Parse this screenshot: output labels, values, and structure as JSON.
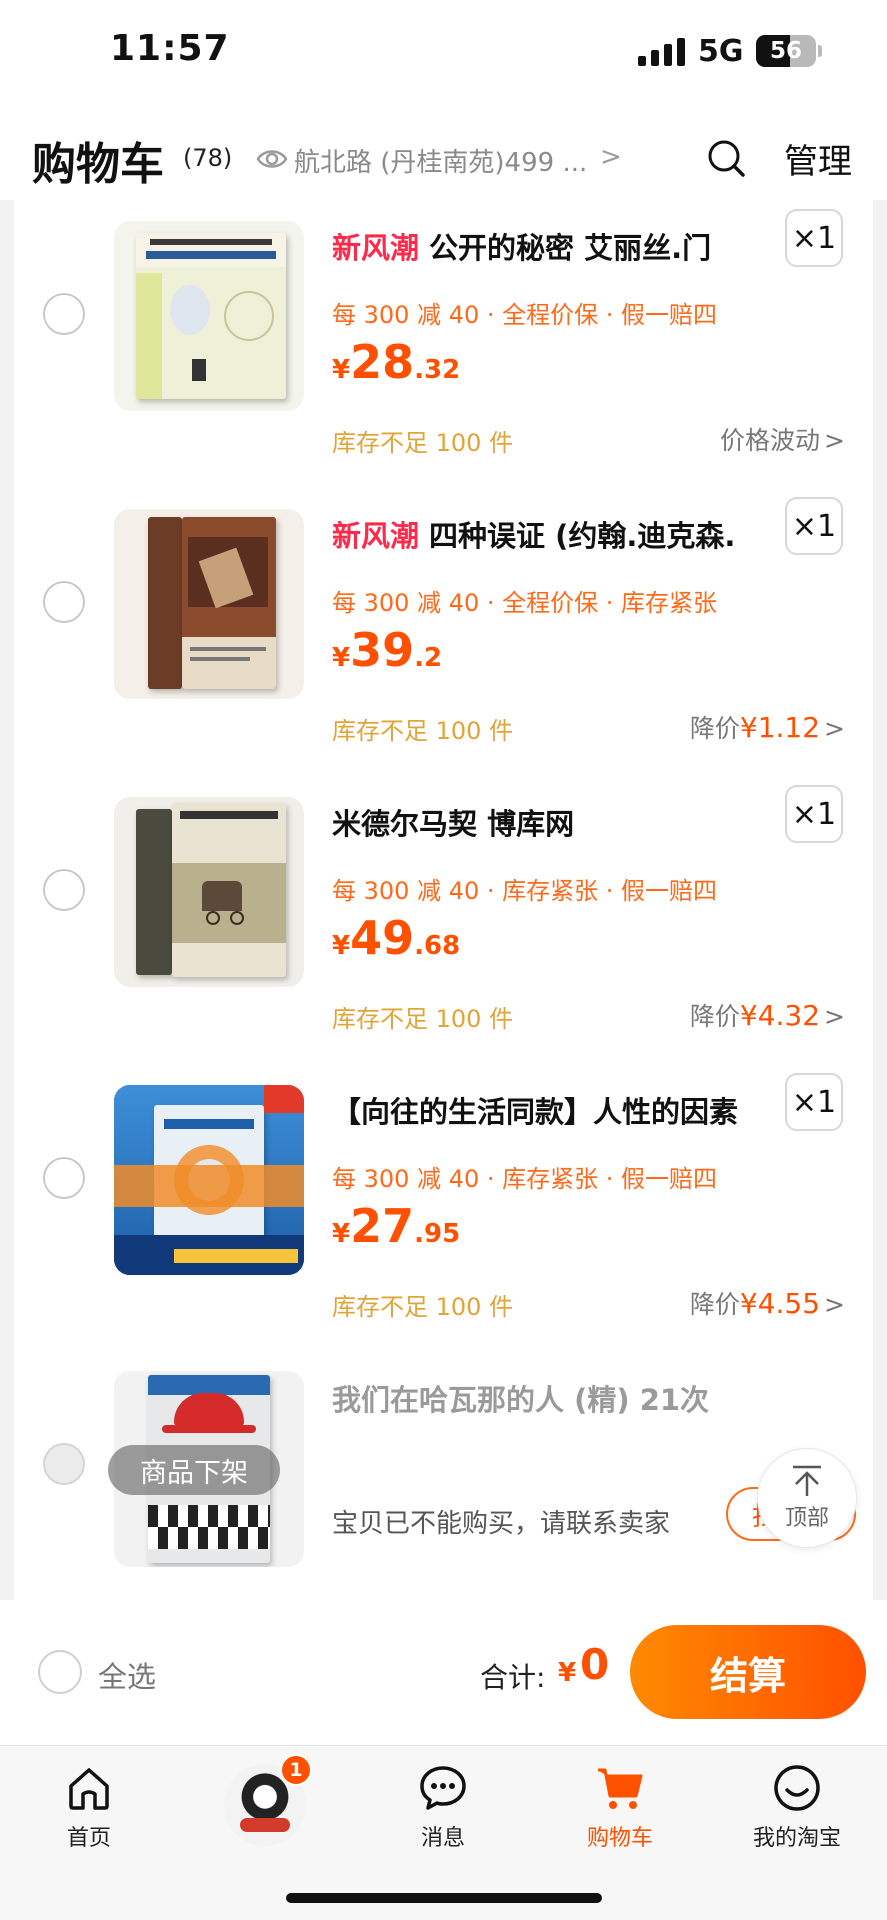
{
  "status_bar": {
    "time": "11:57",
    "network": "5G",
    "battery": "56",
    "battery_level": 0.56
  },
  "header": {
    "title": "购物车",
    "count": "(78)",
    "address": "航北路 (丹桂南苑)499 ...",
    "address_chevron": ">",
    "manage": "管理"
  },
  "items": [
    {
      "tag": "新风潮",
      "title": "公开的秘密 艾丽丝.门",
      "qty": "×1",
      "promo": "每 300 减 40 · 全程价保 · 假一赔四",
      "price_currency": "¥",
      "price_int": "28",
      "price_dec": ".32",
      "stock": "库存不足 100 件",
      "tail_label": "价格波动",
      "tail_amount": "",
      "tail_chevron": ">"
    },
    {
      "tag": "新风潮",
      "title": "四种误证 (约翰.迪克森.",
      "qty": "×1",
      "promo": "每 300 减 40 · 全程价保 · 库存紧张",
      "price_currency": "¥",
      "price_int": "39",
      "price_dec": ".2",
      "stock": "库存不足 100 件",
      "tail_label": "降价",
      "tail_amount": "¥1.12",
      "tail_chevron": ">"
    },
    {
      "tag": "",
      "title": "米德尔马契 博库网",
      "qty": "×1",
      "promo": "每 300 减 40 · 库存紧张 · 假一赔四",
      "price_currency": "¥",
      "price_int": "49",
      "price_dec": ".68",
      "stock": "库存不足 100 件",
      "tail_label": "降价",
      "tail_amount": "¥4.32",
      "tail_chevron": ">"
    },
    {
      "tag": "",
      "title": "【向往的生活同款】人性的因素",
      "qty": "×1",
      "promo": "每 300 减 40 · 库存紧张 · 假一赔四",
      "price_currency": "¥",
      "price_int": "27",
      "price_dec": ".95",
      "stock": "库存不足 100 件",
      "tail_label": "降价",
      "tail_amount": "¥4.55",
      "tail_chevron": ">"
    }
  ],
  "unavailable_item": {
    "title": "我们在哈瓦那的人 (精) 21次",
    "overlay": "商品下架",
    "notice": "宝贝已不能购买，请联系卖家",
    "action": "找"
  },
  "top_button": {
    "label": "顶部"
  },
  "checkout": {
    "select_all": "全选",
    "total_label": "合计:",
    "total_currency": "¥",
    "total_value": "0",
    "pay_label": "结算"
  },
  "tabbar": {
    "home": "首页",
    "badge": "1",
    "messages": "消息",
    "cart": "购物车",
    "mine": "我的淘宝"
  },
  "colors": {
    "accent": "#ff5000",
    "promo": "#ff6a1a",
    "new_tag": "#ff2a4a",
    "stock": "#e0a43a"
  }
}
